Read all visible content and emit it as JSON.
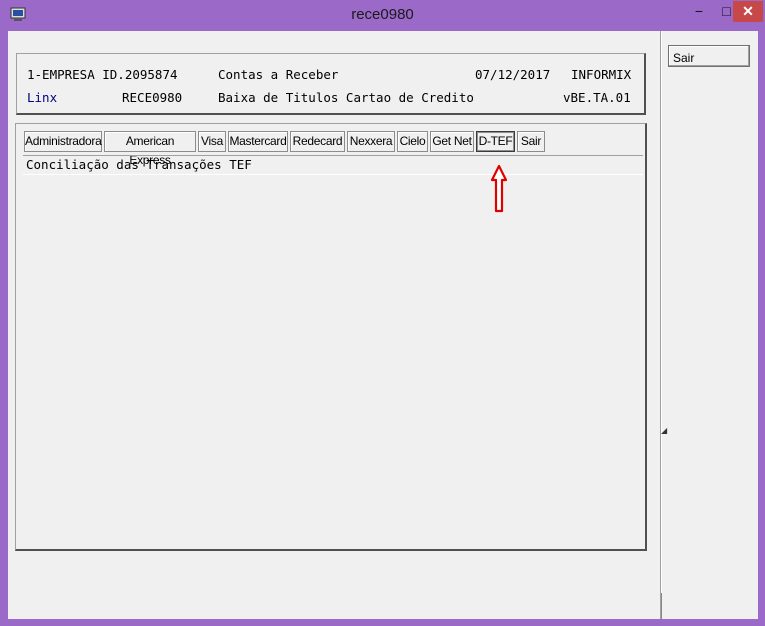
{
  "window": {
    "title": "rece0980",
    "minimize_glyph": "−",
    "maximize_glyph": "□",
    "close_glyph": "✕"
  },
  "header": {
    "row1": {
      "company": "1-EMPRESA ID.2095874",
      "module": "Contas a Receber",
      "date": "07/12/2017",
      "db": "INFORMIX"
    },
    "row2": {
      "brand": "Linx",
      "program": "RECE0980",
      "description": "Baixa de Titulos Cartao de Credito",
      "version": "vBE.TA.01"
    }
  },
  "tabs": [
    {
      "label": "Administradora"
    },
    {
      "label": "American Express"
    },
    {
      "label": "Visa"
    },
    {
      "label": "Mastercard"
    },
    {
      "label": "Redecard"
    },
    {
      "label": "Nexxera"
    },
    {
      "label": "Cielo"
    },
    {
      "label": "Get Net"
    },
    {
      "label": "D-TEF"
    },
    {
      "label": "Sair"
    }
  ],
  "active_tab": "D-TEF",
  "info_text": "Conciliação das Transações TEF",
  "side": {
    "exit_label": "Sair"
  },
  "colors": {
    "titlebar": "#9b6ac9",
    "close_button": "#c74848",
    "brand_text": "#000080",
    "annotation_arrow": "#e00000"
  },
  "icons": {
    "app": "terminal-window-icon",
    "annotation": "red-arrow-up-icon"
  }
}
